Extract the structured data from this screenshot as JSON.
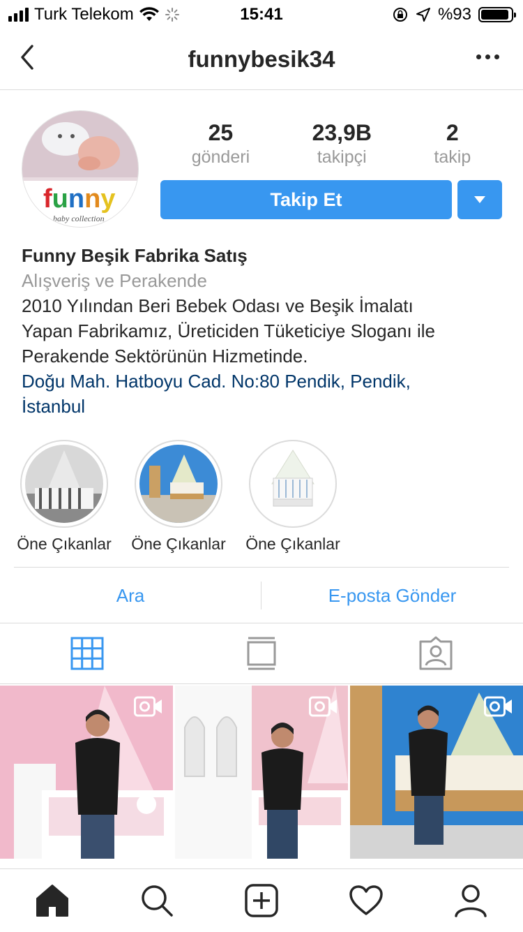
{
  "status_bar": {
    "carrier": "Turk Telekom",
    "time": "15:41",
    "battery": "%93",
    "battery_level": 0.93,
    "icons": [
      "signal-icon",
      "wifi-icon",
      "loading-icon",
      "rotation-lock-icon",
      "location-icon",
      "battery-icon"
    ]
  },
  "nav": {
    "title": "funnybesik34",
    "back_icon": "chevron-left-icon",
    "more_icon": "more-horizontal-icon"
  },
  "profile": {
    "stats": [
      {
        "value": "25",
        "label": "gönderi"
      },
      {
        "value": "23,9B",
        "label": "takipçi"
      },
      {
        "value": "2",
        "label": "takip"
      }
    ],
    "follow_label": "Takip Et",
    "dropdown_icon": "caret-down-icon",
    "accent_color": "#3897f0"
  },
  "bio": {
    "name": "Funny Beşik Fabrika Satış",
    "category": "Alışveriş ve Perakende",
    "text_lines": [
      "2010 Yılından Beri Bebek Odası ve Beşik İmalatı",
      "Yapan Fabrikamız, Üreticiden Tüketiciye Sloganı ile",
      "Perakende Sektörünün Hizmetinde."
    ],
    "address_lines": [
      "Doğu Mah. Hatboyu Cad. No:80 Pendik, Pendik,",
      "İstanbul"
    ]
  },
  "highlights": [
    {
      "label": "Öne Çıkanlar"
    },
    {
      "label": "Öne Çıkanlar"
    },
    {
      "label": "Öne Çıkanlar"
    }
  ],
  "contact": {
    "call_label": "Ara",
    "email_label": "E-posta Gönder"
  },
  "tabs": [
    "grid-icon",
    "feed-icon",
    "tagged-icon"
  ],
  "bottom_nav": [
    "home-icon",
    "search-icon",
    "add-icon",
    "heart-icon",
    "profile-icon"
  ]
}
